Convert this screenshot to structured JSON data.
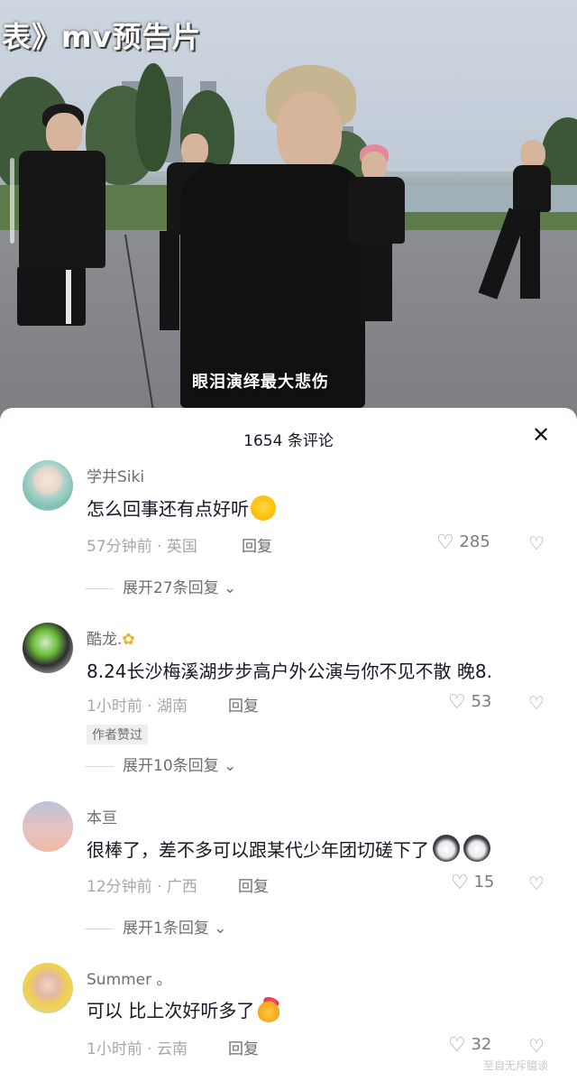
{
  "video": {
    "title": "表》mv预告片",
    "subtitle": "眼泪演绎最大悲伤"
  },
  "comments_panel": {
    "title": "1654 条评论",
    "close_icon": "close-icon"
  },
  "comments": [
    {
      "username": "学井Siki",
      "text": "怎么回事还有点好听",
      "emoji": "sweat-smile-emoji",
      "time": "57分钟前 · 英国",
      "reply_label": "回复",
      "likes": "285",
      "expand": "展开27条回复"
    },
    {
      "username": "酷龙.",
      "username_emoji": "flower-emoji",
      "text": "8.24长沙梅溪湖步步高户外公演与你不见不散 晚8.",
      "time": "1小时前 · 湖南",
      "reply_label": "回复",
      "likes": "53",
      "badge": "作者赞过",
      "expand": "展开10条回复"
    },
    {
      "username": "本亘",
      "text": "很棒了，差不多可以跟某代少年团切磋下了",
      "emoji": "husky-emoji",
      "time": "12分钟前 · 广西",
      "reply_label": "回复",
      "likes": "15",
      "expand": "展开1条回复"
    },
    {
      "username": "Summer 。",
      "text": "可以 比上次好听多了",
      "emoji": "finger-heart-emoji",
      "time": "1小时前 · 云南",
      "reply_label": "回复",
      "likes": "32"
    }
  ],
  "watermark": "至自无斥臆谈",
  "colors": {
    "text_primary": "#161823",
    "text_secondary": "#6d6e73",
    "text_meta": "#a6a7ab",
    "panel_bg": "#ffffff"
  }
}
